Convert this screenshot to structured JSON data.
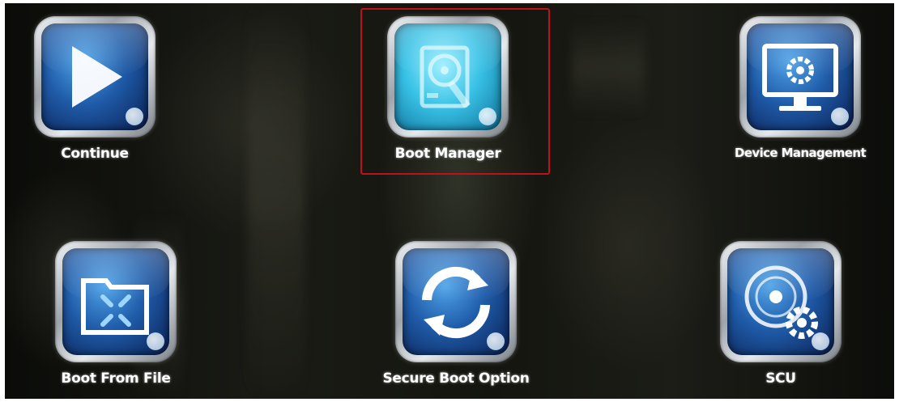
{
  "menu": {
    "items": [
      {
        "label": "Continue",
        "icon": "play-icon"
      },
      {
        "label": "Boot Manager",
        "icon": "boot-manager-icon",
        "selected": true
      },
      {
        "label": "Device Management",
        "icon": "device-management-icon"
      },
      {
        "label": "Boot From File",
        "icon": "boot-from-file-icon"
      },
      {
        "label": "Secure Boot Option",
        "icon": "secure-boot-icon"
      },
      {
        "label": "SCU",
        "icon": "scu-icon"
      }
    ],
    "selection_color": "#c0101a",
    "accent_blue": "#1f5ba8",
    "accent_cyan": "#38c2e6"
  }
}
